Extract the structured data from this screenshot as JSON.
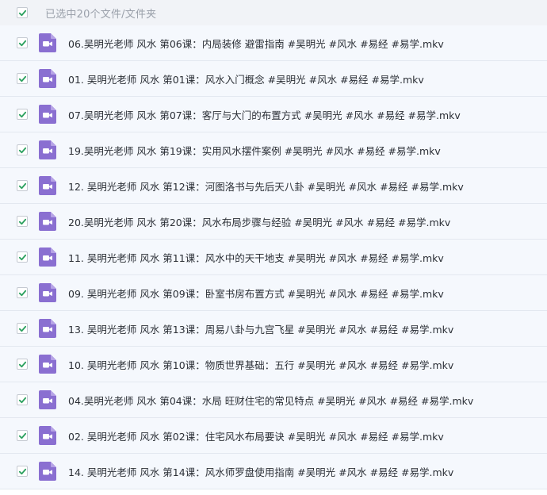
{
  "header": {
    "select_all_checked": true,
    "selection_text": "已选中20个文件/文件夹"
  },
  "colors": {
    "check_green": "#2da160",
    "video_icon_purple": "#8a6fd1",
    "row_bg": "#f5f8fd",
    "header_bg": "#f1f3f7"
  },
  "icons": {
    "file": "video-file-icon",
    "check": "checkmark-icon"
  },
  "files": [
    {
      "name": "06.吴明光老师 风水 第06课：内局装修 避雷指南 #吴明光 #风水 #易经 #易学.mkv",
      "checked": true
    },
    {
      "name": "01. 吴明光老师 风水 第01课：风水入门概念 #吴明光 #风水 #易经 #易学.mkv",
      "checked": true
    },
    {
      "name": "07.吴明光老师 风水 第07课：客厅与大门的布置方式 #吴明光 #风水 #易经 #易学.mkv",
      "checked": true
    },
    {
      "name": "19.吴明光老师 风水 第19课：实用风水摆件案例 #吴明光 #风水 #易经 #易学.mkv",
      "checked": true
    },
    {
      "name": "12. 吴明光老师 风水 第12课：河图洛书与先后天八卦 #吴明光 #风水 #易经 #易学.mkv",
      "checked": true
    },
    {
      "name": "20.吴明光老师 风水 第20课：风水布局步骤与经验 #吴明光 #风水 #易经 #易学.mkv",
      "checked": true
    },
    {
      "name": "11. 吴明光老师 风水 第11课：风水中的天干地支 #吴明光 #风水 #易经 #易学.mkv",
      "checked": true
    },
    {
      "name": "09. 吴明光老师 风水 第09课：卧室书房布置方式 #吴明光 #风水 #易经 #易学.mkv",
      "checked": true
    },
    {
      "name": "13. 吴明光老师 风水 第13课：周易八卦与九宫飞星 #吴明光 #风水 #易经 #易学.mkv",
      "checked": true
    },
    {
      "name": "10. 吴明光老师 风水 第10课：物质世界基础：五行 #吴明光 #风水 #易经 #易学.mkv",
      "checked": true
    },
    {
      "name": "04.吴明光老师 风水 第04课：水局 旺财住宅的常见特点 #吴明光 #风水 #易经 #易学.mkv",
      "checked": true
    },
    {
      "name": "02. 吴明光老师 风水 第02课：住宅风水布局要诀 #吴明光 #风水 #易经 #易学.mkv",
      "checked": true
    },
    {
      "name": "14. 吴明光老师 风水 第14课：风水师罗盘使用指南 #吴明光 #风水 #易经 #易学.mkv",
      "checked": true
    }
  ]
}
